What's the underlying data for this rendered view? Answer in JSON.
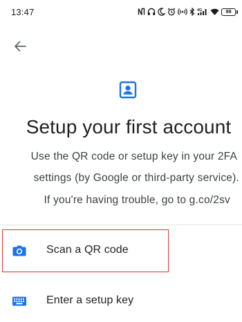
{
  "status_bar": {
    "time": "13:47",
    "battery_level": "98",
    "network_label": "4G",
    "icons": [
      "nfc-icon",
      "headphones-icon",
      "moon-icon",
      "alarm-icon",
      "hotspot-icon",
      "bluetooth-icon",
      "signal-icon",
      "wifi-icon",
      "battery-icon"
    ]
  },
  "header": {
    "back_icon": "arrow-left-icon"
  },
  "hero": {
    "icon": "account-box-icon",
    "title": "Setup your first account",
    "description_lines": [
      "Use the QR code or setup key in your 2FA",
      "settings (by Google or third-party service).",
      "If you're having trouble, go to g.co/2sv"
    ]
  },
  "options": [
    {
      "label": "Scan a QR code",
      "icon": "camera-icon"
    },
    {
      "label": "Enter a setup key",
      "icon": "keyboard-icon"
    }
  ],
  "colors": {
    "accent": "#1a73e8",
    "highlight": "#e0303a",
    "text": "#202124",
    "divider": "#e3e3e3"
  }
}
